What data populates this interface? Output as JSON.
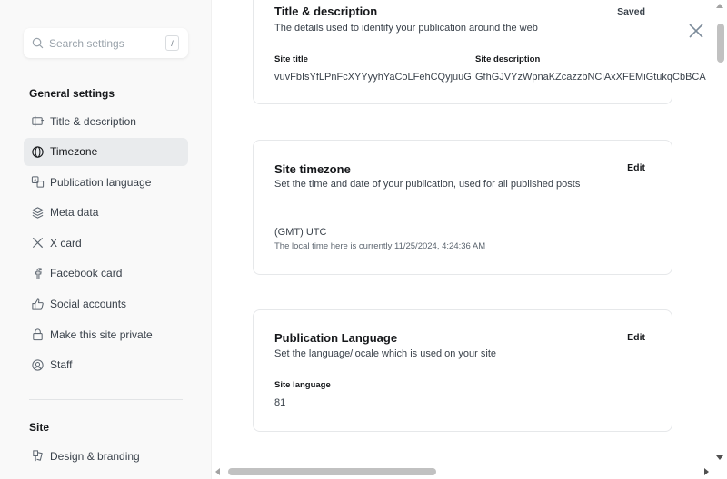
{
  "search": {
    "placeholder": "Search settings",
    "shortcut": "/"
  },
  "sidebar": {
    "section_general": "General settings",
    "items": [
      {
        "label": "Title & description",
        "icon": "title-icon"
      },
      {
        "label": "Timezone",
        "icon": "globe-icon"
      },
      {
        "label": "Publication language",
        "icon": "language-icon"
      },
      {
        "label": "Meta data",
        "icon": "layers-icon"
      },
      {
        "label": "X card",
        "icon": "x-logo-icon"
      },
      {
        "label": "Facebook card",
        "icon": "facebook-icon"
      },
      {
        "label": "Social accounts",
        "icon": "thumbs-up-icon"
      },
      {
        "label": "Make this site private",
        "icon": "lock-icon"
      },
      {
        "label": "Staff",
        "icon": "staff-icon"
      }
    ],
    "active_item": "Timezone",
    "section_site": "Site",
    "site_items": [
      {
        "label": "Design & branding",
        "icon": "brush-icon"
      }
    ]
  },
  "cards": {
    "title_desc": {
      "title": "Title & description",
      "subtitle": "The details used to identify your publication around the web",
      "status": "Saved",
      "site_title_label": "Site title",
      "site_title_value": "vuvFbIsYfLPnFcXYYyyhYaCoLFehCQyjuuG",
      "site_desc_label": "Site description",
      "site_desc_value": "GfhGJVYzWpnaKZcazzbNCiAxXFEMiGtukqCbBCA"
    },
    "timezone": {
      "title": "Site timezone",
      "subtitle": "Set the time and date of your publication, used for all published posts",
      "action": "Edit",
      "value": "(GMT) UTC",
      "local_time": "The local time here is currently 11/25/2024, 4:24:36 AM"
    },
    "language": {
      "title": "Publication Language",
      "subtitle": "Set the language/locale which is used on your site",
      "action": "Edit",
      "label": "Site language",
      "value": "81"
    }
  }
}
